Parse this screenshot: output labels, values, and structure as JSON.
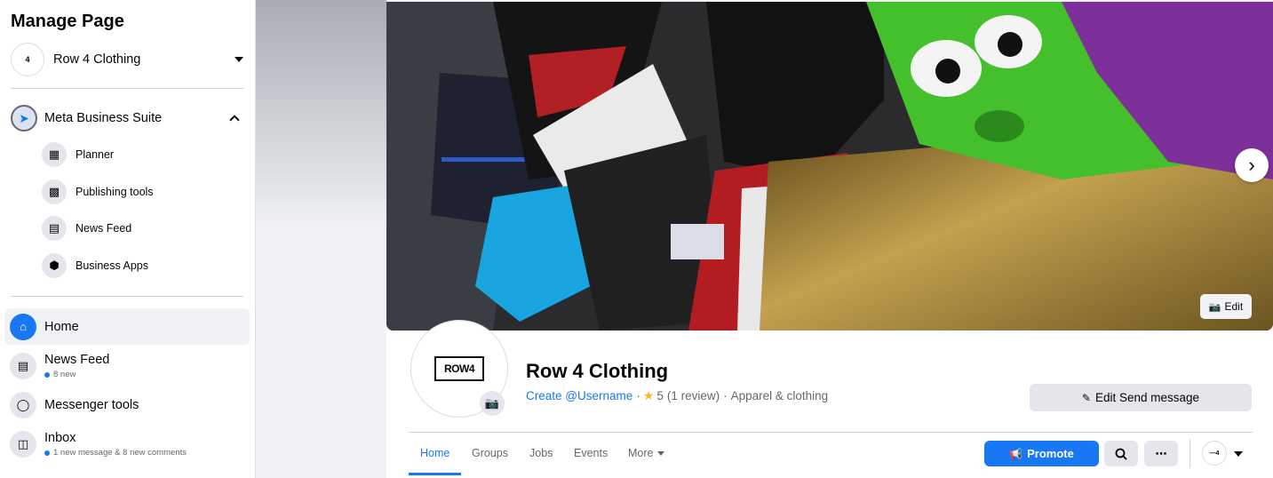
{
  "sidebar": {
    "title": "Manage Page",
    "page_switcher": {
      "name": "Row 4 Clothing",
      "avatar_text": "4"
    },
    "business_suite": {
      "label": "Meta Business Suite",
      "items": [
        {
          "label": "Planner",
          "icon": "calendar-icon"
        },
        {
          "label": "Publishing tools",
          "icon": "publishing-icon"
        },
        {
          "label": "News Feed",
          "icon": "news-feed-icon"
        },
        {
          "label": "Business Apps",
          "icon": "cube-icon"
        }
      ]
    },
    "nav": [
      {
        "label": "Home",
        "sub": "",
        "icon": "home-icon",
        "active": true
      },
      {
        "label": "News Feed",
        "sub": "8 new",
        "icon": "news-feed-icon"
      },
      {
        "label": "Messenger tools",
        "sub": "",
        "icon": "messenger-icon"
      },
      {
        "label": "Inbox",
        "sub": "1 new message & 8 new comments",
        "icon": "inbox-icon"
      }
    ]
  },
  "cover": {
    "edit_label": "Edit"
  },
  "profile": {
    "logo_text": "ROW4",
    "name": "Row 4 Clothing",
    "username_link": "Create @Username",
    "sep1": "·",
    "rating": "5",
    "reviews": "(1 review)",
    "sep2": "·",
    "category": "Apparel & clothing",
    "edit_send_label": "Edit Send message"
  },
  "tabs": [
    {
      "label": "Home",
      "active": true
    },
    {
      "label": "Groups"
    },
    {
      "label": "Jobs"
    },
    {
      "label": "Events"
    },
    {
      "label": "More"
    }
  ],
  "actions": {
    "promote_label": "Promote",
    "search_icon": "search-icon",
    "more_icon": "ellipsis-icon"
  },
  "colors": {
    "accent": "#1877f2",
    "background": "#f0f2f5",
    "button_gray": "#e4e6eb"
  }
}
